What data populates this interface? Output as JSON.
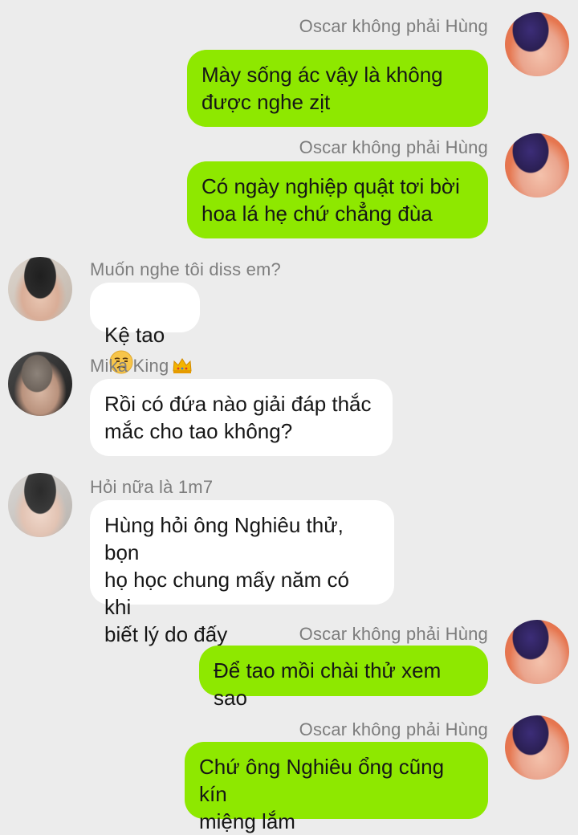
{
  "messages": [
    {
      "side": "out",
      "sender": "Oscar không phải Hùng",
      "text": "Mày sống ác vậy là không\nđược nghe zịt",
      "avatar": "oscar-avatar"
    },
    {
      "side": "out",
      "sender": "Oscar không phải Hùng",
      "text": "Có ngày nghiệp quật tơi bời\nhoa lá hẹ chứ chẳng đùa",
      "avatar": "oscar-avatar"
    },
    {
      "side": "in",
      "sender": "Muốn nghe tôi diss em?",
      "text": "Kệ tao",
      "emoji": "unamused-face-emoji",
      "avatar": "user-avatar"
    },
    {
      "side": "in",
      "sender": "Mika King",
      "sender_icon": "crown-icon",
      "text": "Rồi có đứa nào giải đáp thắc\nmắc cho tao không?",
      "avatar": "user-avatar"
    },
    {
      "side": "in",
      "sender": "Hỏi nữa là 1m7",
      "text": "Hùng hỏi ông Nghiêu thử, bọn\nhọ học chung mấy năm có khi\nbiết lý do đấy",
      "avatar": "user-avatar"
    },
    {
      "side": "out",
      "sender": "Oscar không phải Hùng",
      "text": "Để tao mồi chài thử xem sao",
      "avatar": "oscar-avatar"
    },
    {
      "side": "out",
      "sender": "Oscar không phải Hùng",
      "text": "Chứ ông Nghiêu ổng cũng kín\nmiệng lắm",
      "avatar": "oscar-avatar"
    }
  ],
  "colors": {
    "background": "#ececec",
    "outgoing_bubble": "#8ee800",
    "incoming_bubble": "#ffffff",
    "sender_name": "#7d7d7d"
  }
}
